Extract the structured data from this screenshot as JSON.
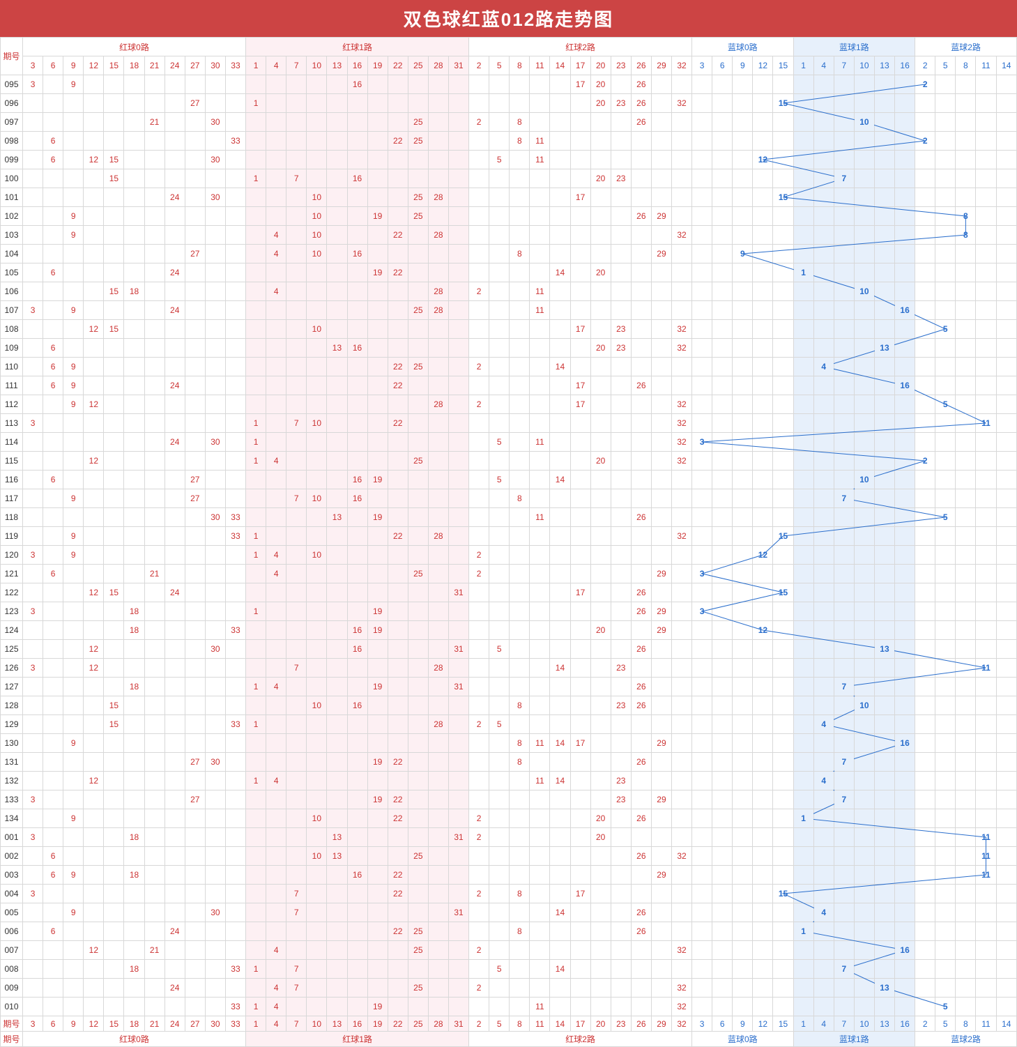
{
  "title": "双色球红蓝012路走势图",
  "labels": {
    "period": "期号"
  },
  "groups": [
    {
      "label": "红球0路",
      "nums": [
        3,
        6,
        9,
        12,
        15,
        18,
        21,
        24,
        27,
        30,
        33
      ],
      "cls": "hdr-red",
      "bg": ""
    },
    {
      "label": "红球1路",
      "nums": [
        1,
        4,
        7,
        10,
        13,
        16,
        19,
        22,
        25,
        28,
        31
      ],
      "cls": "hdr-red",
      "bg": "bg-pink"
    },
    {
      "label": "红球2路",
      "nums": [
        2,
        5,
        8,
        11,
        14,
        17,
        20,
        23,
        26,
        29,
        32
      ],
      "cls": "hdr-red",
      "bg": ""
    },
    {
      "label": "蓝球0路",
      "nums": [
        3,
        6,
        9,
        12,
        15
      ],
      "cls": "hdr-blue",
      "bg": ""
    },
    {
      "label": "蓝球1路",
      "nums": [
        1,
        4,
        7,
        10,
        13,
        16
      ],
      "cls": "hdr-blue",
      "bg": "bg-blue"
    },
    {
      "label": "蓝球2路",
      "nums": [
        2,
        5,
        8,
        11,
        14
      ],
      "cls": "hdr-blue",
      "bg": ""
    }
  ],
  "chart_data": {
    "type": "table",
    "title": "双色球红蓝012路走势图",
    "columns": {
      "red0": [
        3,
        6,
        9,
        12,
        15,
        18,
        21,
        24,
        27,
        30,
        33
      ],
      "red1": [
        1,
        4,
        7,
        10,
        13,
        16,
        19,
        22,
        25,
        28,
        31
      ],
      "red2": [
        2,
        5,
        8,
        11,
        14,
        17,
        20,
        23,
        26,
        29,
        32
      ],
      "blue0": [
        3,
        6,
        9,
        12,
        15
      ],
      "blue1": [
        1,
        4,
        7,
        10,
        13,
        16
      ],
      "blue2": [
        2,
        5,
        8,
        11,
        14
      ]
    },
    "rows": [
      {
        "period": "095",
        "red": [
          3,
          9,
          16,
          17,
          20,
          26
        ],
        "blue": 2
      },
      {
        "period": "096",
        "red": [
          27,
          1,
          20,
          23,
          26,
          32
        ],
        "blue": 15
      },
      {
        "period": "097",
        "red": [
          21,
          30,
          25,
          2,
          8,
          26
        ],
        "blue": 10
      },
      {
        "period": "098",
        "red": [
          6,
          33,
          22,
          25,
          8,
          11
        ],
        "blue": 2
      },
      {
        "period": "099",
        "red": [
          6,
          12,
          15,
          30,
          5,
          11
        ],
        "blue": 12
      },
      {
        "period": "100",
        "red": [
          15,
          1,
          7,
          16,
          20,
          23
        ],
        "blue": 7
      },
      {
        "period": "101",
        "red": [
          24,
          30,
          10,
          25,
          28,
          17
        ],
        "blue": 15
      },
      {
        "period": "102",
        "red": [
          9,
          10,
          19,
          25,
          26,
          29
        ],
        "blue": 8
      },
      {
        "period": "103",
        "red": [
          9,
          4,
          10,
          22,
          28,
          32
        ],
        "blue": 8
      },
      {
        "period": "104",
        "red": [
          27,
          4,
          10,
          16,
          8,
          29
        ],
        "blue": 9
      },
      {
        "period": "105",
        "red": [
          6,
          24,
          19,
          22,
          14,
          20
        ],
        "blue": 1
      },
      {
        "period": "106",
        "red": [
          15,
          18,
          4,
          28,
          2,
          11
        ],
        "blue": 10
      },
      {
        "period": "107",
        "red": [
          3,
          9,
          24,
          25,
          28,
          11
        ],
        "blue": 16
      },
      {
        "period": "108",
        "red": [
          12,
          15,
          10,
          17,
          23,
          32
        ],
        "blue": 5
      },
      {
        "period": "109",
        "red": [
          6,
          13,
          16,
          20,
          23,
          32
        ],
        "blue": 13
      },
      {
        "period": "110",
        "red": [
          6,
          9,
          22,
          25,
          2,
          14
        ],
        "blue": 4
      },
      {
        "period": "111",
        "red": [
          6,
          9,
          24,
          22,
          17,
          26
        ],
        "blue": 16
      },
      {
        "period": "112",
        "red": [
          9,
          12,
          28,
          2,
          17,
          32
        ],
        "blue": 5
      },
      {
        "period": "113",
        "red": [
          3,
          1,
          7,
          10,
          22,
          32
        ],
        "blue": 11
      },
      {
        "period": "114",
        "red": [
          24,
          30,
          1,
          5,
          11,
          32
        ],
        "blue": 3
      },
      {
        "period": "115",
        "red": [
          12,
          1,
          4,
          25,
          20,
          32
        ],
        "blue": 2
      },
      {
        "period": "116",
        "red": [
          6,
          27,
          16,
          19,
          5,
          14
        ],
        "blue": 10
      },
      {
        "period": "117",
        "red": [
          9,
          27,
          7,
          10,
          16,
          8
        ],
        "blue": 7
      },
      {
        "period": "118",
        "red": [
          30,
          33,
          13,
          19,
          11,
          26
        ],
        "blue": 5
      },
      {
        "period": "119",
        "red": [
          9,
          33,
          1,
          22,
          28,
          32
        ],
        "blue": 15
      },
      {
        "period": "120",
        "red": [
          3,
          9,
          1,
          4,
          10,
          2
        ],
        "blue": 12
      },
      {
        "period": "121",
        "red": [
          6,
          21,
          4,
          25,
          2,
          29
        ],
        "blue": 3
      },
      {
        "period": "122",
        "red": [
          12,
          15,
          24,
          31,
          17,
          26
        ],
        "blue": 15
      },
      {
        "period": "123",
        "red": [
          3,
          18,
          1,
          19,
          26,
          29
        ],
        "blue": 3
      },
      {
        "period": "124",
        "red": [
          18,
          33,
          16,
          19,
          20,
          29
        ],
        "blue": 12
      },
      {
        "period": "125",
        "red": [
          12,
          30,
          16,
          31,
          5,
          26
        ],
        "blue": 13
      },
      {
        "period": "126",
        "red": [
          3,
          12,
          7,
          28,
          14,
          23
        ],
        "blue": 11
      },
      {
        "period": "127",
        "red": [
          18,
          1,
          4,
          19,
          31,
          26
        ],
        "blue": 7
      },
      {
        "period": "128",
        "red": [
          15,
          10,
          16,
          8,
          23,
          26
        ],
        "blue": 10
      },
      {
        "period": "129",
        "red": [
          15,
          33,
          1,
          28,
          2,
          5
        ],
        "blue": 4
      },
      {
        "period": "130",
        "red": [
          9,
          8,
          11,
          14,
          17,
          29
        ],
        "blue": 16
      },
      {
        "period": "131",
        "red": [
          27,
          30,
          19,
          22,
          8,
          26
        ],
        "blue": 7
      },
      {
        "period": "132",
        "red": [
          12,
          1,
          4,
          11,
          14,
          23
        ],
        "blue": 4
      },
      {
        "period": "133",
        "red": [
          3,
          27,
          19,
          22,
          23,
          29
        ],
        "blue": 7
      },
      {
        "period": "134",
        "red": [
          9,
          10,
          22,
          2,
          20,
          26
        ],
        "blue": 1
      },
      {
        "period": "001",
        "red": [
          3,
          18,
          13,
          31,
          2,
          20
        ],
        "blue": 11
      },
      {
        "period": "002",
        "red": [
          6,
          10,
          13,
          25,
          26,
          32
        ],
        "blue": 11
      },
      {
        "period": "003",
        "red": [
          6,
          9,
          18,
          16,
          22,
          29
        ],
        "blue": 11
      },
      {
        "period": "004",
        "red": [
          3,
          7,
          22,
          2,
          8,
          17
        ],
        "blue": 15
      },
      {
        "period": "005",
        "red": [
          9,
          30,
          7,
          31,
          14,
          26
        ],
        "blue": 4
      },
      {
        "period": "006",
        "red": [
          6,
          24,
          22,
          25,
          8,
          26
        ],
        "blue": 1
      },
      {
        "period": "007",
        "red": [
          12,
          21,
          4,
          25,
          2,
          32
        ],
        "blue": 16
      },
      {
        "period": "008",
        "red": [
          18,
          33,
          1,
          7,
          5,
          14
        ],
        "blue": 7
      },
      {
        "period": "009",
        "red": [
          24,
          4,
          7,
          25,
          2,
          32
        ],
        "blue": 13
      },
      {
        "period": "010",
        "red": [
          33,
          1,
          4,
          19,
          11,
          32
        ],
        "blue": 5
      }
    ]
  }
}
